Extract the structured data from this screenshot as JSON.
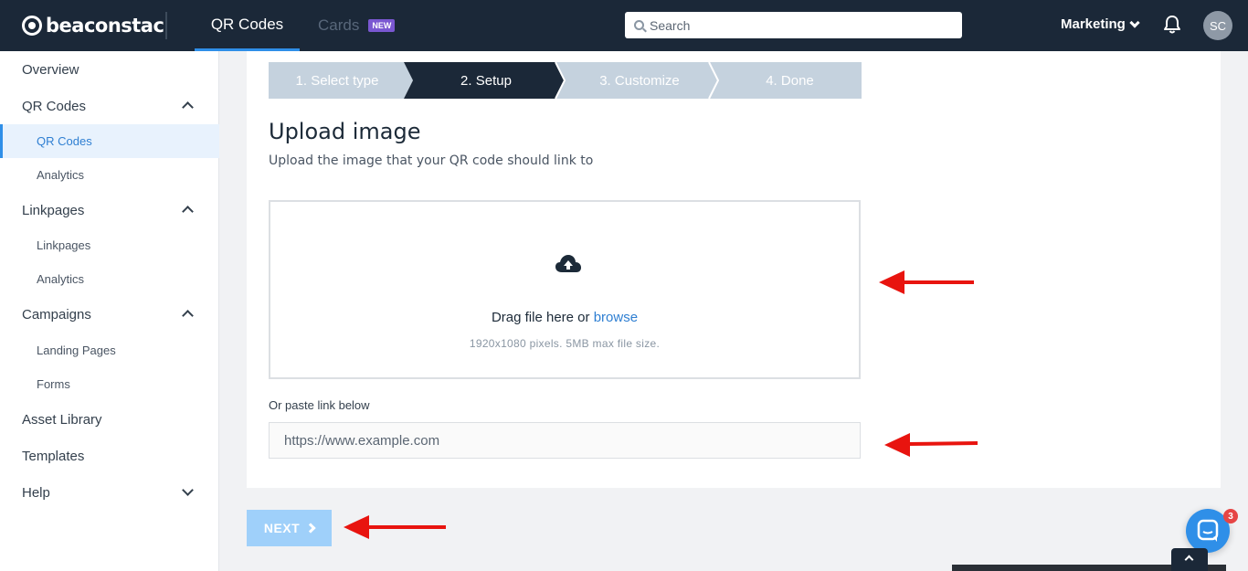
{
  "app": {
    "brand": "beaconstac"
  },
  "topnav": {
    "tabs": [
      {
        "label": "QR Codes"
      },
      {
        "label": "Cards",
        "badge": "NEW"
      }
    ],
    "search_placeholder": "Search",
    "org_label": "Marketing",
    "avatar_initials": "SC"
  },
  "sidebar": {
    "overview": "Overview",
    "qr_codes": "QR Codes",
    "qr_codes_sub": "QR Codes",
    "qr_analytics": "Analytics",
    "linkpages": "Linkpages",
    "linkpages_sub": "Linkpages",
    "linkpages_analytics": "Analytics",
    "campaigns": "Campaigns",
    "landing_pages": "Landing Pages",
    "forms": "Forms",
    "asset_library": "Asset Library",
    "templates": "Templates",
    "help": "Help"
  },
  "steps": [
    {
      "label": "1. Select type",
      "state": "done"
    },
    {
      "label": "2. Setup",
      "state": "active"
    },
    {
      "label": "3. Customize",
      "state": "pending"
    },
    {
      "label": "4. Done",
      "state": "pending"
    }
  ],
  "upload": {
    "title": "Upload image",
    "subtitle": "Upload the image that your QR code should link to",
    "drag_text": "Drag file here or",
    "browse_link": "browse",
    "hint": "1920x1080 pixels. 5MB max file size."
  },
  "paste": {
    "label": "Or paste link below",
    "placeholder": "https://www.example.com",
    "value": ""
  },
  "next_label": "NEXT",
  "chat_badge_count": "3",
  "colors": {
    "topbar": "#1b2838",
    "accent": "#2f8fe8",
    "annotation_arrow": "#e8140f"
  }
}
